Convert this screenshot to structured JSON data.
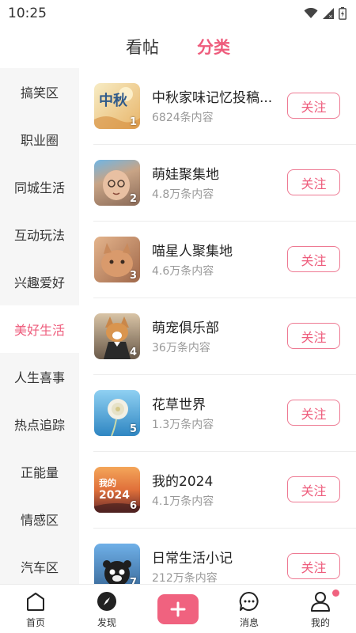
{
  "status_bar": {
    "time": "10:25"
  },
  "top_tabs": [
    {
      "label": "看帖",
      "active": false
    },
    {
      "label": "分类",
      "active": true
    }
  ],
  "sidebar": {
    "items": [
      {
        "label": "搞笑区"
      },
      {
        "label": "职业圈"
      },
      {
        "label": "同城生活"
      },
      {
        "label": "互动玩法"
      },
      {
        "label": "兴趣爱好"
      },
      {
        "label": "美好生活",
        "active": true
      },
      {
        "label": "人生喜事"
      },
      {
        "label": "热点追踪"
      },
      {
        "label": "正能量"
      },
      {
        "label": "情感区"
      },
      {
        "label": "汽车区"
      }
    ]
  },
  "list": {
    "items": [
      {
        "rank": "1",
        "title": "中秋家味记忆投稿...",
        "sub": "6824条内容",
        "follow": "关注",
        "thumb_text": "中秋",
        "thumb_colors": [
          "#f6e7b6",
          "#e4b46a"
        ]
      },
      {
        "rank": "2",
        "title": "萌娃聚集地",
        "sub": "4.8万条内容",
        "follow": "关注",
        "thumb_colors": [
          "#cfa88a",
          "#8a6a57"
        ]
      },
      {
        "rank": "3",
        "title": "喵星人聚集地",
        "sub": "4.6万条内容",
        "follow": "关注",
        "thumb_colors": [
          "#d8a07a",
          "#8c5a3e"
        ]
      },
      {
        "rank": "4",
        "title": "萌宠俱乐部",
        "sub": "36万条内容",
        "follow": "关注",
        "thumb_colors": [
          "#c8a27a",
          "#3a3030"
        ]
      },
      {
        "rank": "5",
        "title": "花草世界",
        "sub": "1.3万条内容",
        "follow": "关注",
        "thumb_colors": [
          "#7fc3e6",
          "#2e7fb8"
        ]
      },
      {
        "rank": "6",
        "title": "我的2024",
        "sub": "4.1万条内容",
        "follow": "关注",
        "thumb_text": "我的 2024",
        "thumb_colors": [
          "#f09a54",
          "#7a2a2a"
        ]
      },
      {
        "rank": "7",
        "title": "日常生活小记",
        "sub": "212万条内容",
        "follow": "关注",
        "thumb_colors": [
          "#6fb0e8",
          "#2a2a2a"
        ]
      }
    ]
  },
  "bottom_nav": {
    "items": [
      {
        "label": "首页"
      },
      {
        "label": "发现"
      },
      {
        "label": ""
      },
      {
        "label": "消息"
      },
      {
        "label": "我的"
      }
    ]
  },
  "colors": {
    "accent": "#ee5c7c",
    "sidebar_bg": "#f6f6f6",
    "divider": "#ececec"
  }
}
